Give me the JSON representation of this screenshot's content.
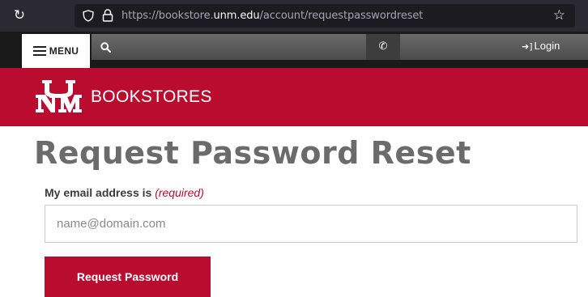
{
  "browser": {
    "url_prefix": "https://bookstore.",
    "url_host": "unm.edu",
    "url_path": "/account/requestpasswordreset"
  },
  "nav": {
    "menu_label": "MENU",
    "login_label": "Login"
  },
  "banner": {
    "brand": "BOOKSTORES"
  },
  "form": {
    "title": "Request Password Reset",
    "email_label": "My email address is",
    "required_text": "(required)",
    "email_placeholder": "name@domain.com",
    "email_value": "",
    "submit_label": "Request Password"
  },
  "colors": {
    "brand_red": "#ba0c2f",
    "nav_dark": "#1a1a1a",
    "title_gray": "#6b6b6b"
  },
  "icons": {
    "reload": "reload-icon",
    "shield": "shield-icon",
    "lock": "lock-icon",
    "bookmark": "star-icon",
    "menu": "hamburger-icon",
    "search": "search-icon",
    "phone": "phone-icon",
    "login": "sign-in-icon"
  }
}
